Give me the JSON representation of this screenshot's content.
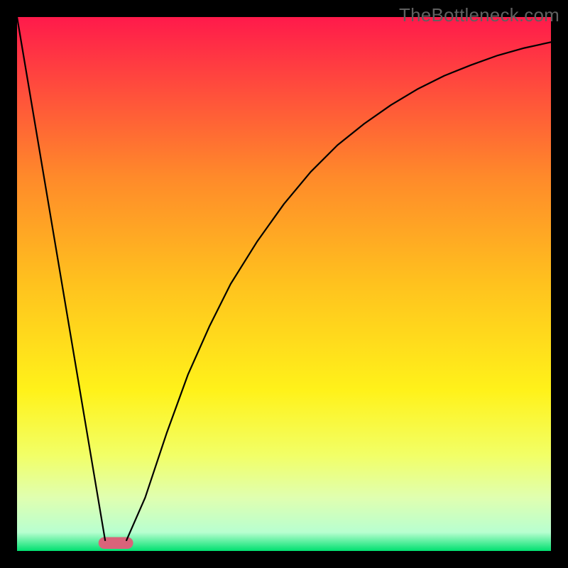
{
  "watermark": "TheBottleneck.com",
  "chart_data": {
    "type": "line",
    "title": "",
    "xlabel": "",
    "ylabel": "",
    "xlim": [
      0,
      100
    ],
    "ylim": [
      0,
      100
    ],
    "grid": false,
    "legend": false,
    "background": {
      "type": "vertical-gradient",
      "stops": [
        {
          "pos": 0.0,
          "color": "#ff1a4b"
        },
        {
          "pos": 0.1,
          "color": "#ff4040"
        },
        {
          "pos": 0.3,
          "color": "#ff8a2a"
        },
        {
          "pos": 0.5,
          "color": "#ffc21e"
        },
        {
          "pos": 0.7,
          "color": "#fff21a"
        },
        {
          "pos": 0.82,
          "color": "#f2ff66"
        },
        {
          "pos": 0.9,
          "color": "#e0ffb0"
        },
        {
          "pos": 0.965,
          "color": "#b8ffd0"
        },
        {
          "pos": 1.0,
          "color": "#00e070"
        }
      ]
    },
    "series": [
      {
        "name": "left-line",
        "x": [
          0,
          16.5
        ],
        "values": [
          100,
          2
        ],
        "color": "#000000",
        "width": 2.2
      },
      {
        "name": "right-curve",
        "x": [
          20.5,
          24,
          28,
          32,
          36,
          40,
          45,
          50,
          55,
          60,
          65,
          70,
          75,
          80,
          85,
          90,
          95,
          100
        ],
        "values": [
          2,
          10,
          22,
          33,
          42,
          50,
          58,
          65,
          71,
          76,
          80,
          83.5,
          86.5,
          89,
          91,
          92.8,
          94.2,
          95.3
        ],
        "color": "#000000",
        "width": 2.2
      }
    ],
    "marker": {
      "shape": "pill",
      "cx": 18.5,
      "cy": 1.5,
      "w": 6.5,
      "h": 2.2,
      "fill": "#d9637a"
    }
  }
}
